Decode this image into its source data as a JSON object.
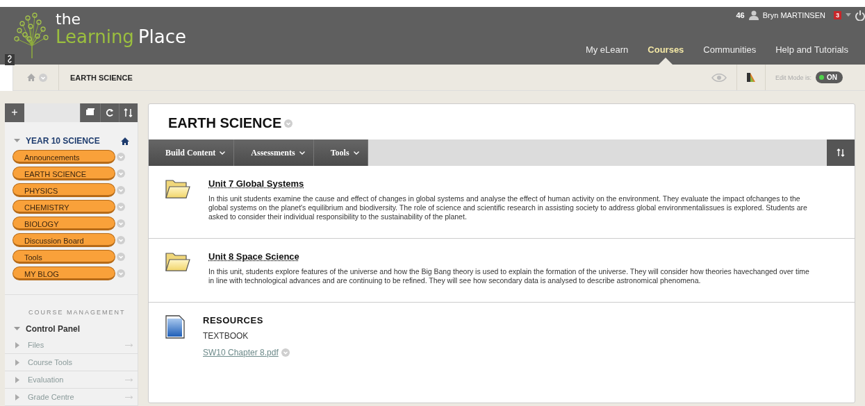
{
  "header": {
    "logo": {
      "small": "the",
      "green": "Learning",
      "white": "Place"
    },
    "user_count": "46",
    "user_name": "Bryn MARTINSEN",
    "notification_count": "3",
    "nav": [
      {
        "label": "My eLearn",
        "selected": false
      },
      {
        "label": "Courses",
        "selected": true
      },
      {
        "label": "Communities",
        "selected": false
      },
      {
        "label": "Help and Tutorials",
        "selected": false
      }
    ]
  },
  "breadcrumb": {
    "current": "EARTH SCIENCE",
    "edit_mode_label": "Edit Mode is:",
    "edit_mode": {
      "label": "ON",
      "on": true
    }
  },
  "sidebar": {
    "add_label": "+",
    "course_title": "YEAR 10 SCIENCE",
    "course_expanded": true,
    "menu_items": [
      {
        "label": "Announcements"
      },
      {
        "label": "EARTH SCIENCE"
      },
      {
        "label": "PHYSICS"
      },
      {
        "label": "CHEMISTRY"
      },
      {
        "label": "BIOLOGY"
      },
      {
        "label": "Discussion Board"
      },
      {
        "label": "Tools"
      },
      {
        "label": "MY BLOG"
      }
    ],
    "management_heading": "COURSE MANAGEMENT",
    "control_panel": {
      "label": "Control Panel",
      "expanded": true,
      "items": [
        {
          "label": "Files",
          "expanded": false,
          "link_arrow": true
        },
        {
          "label": "Course Tools",
          "expanded": false,
          "link_arrow": false
        },
        {
          "label": "Evaluation",
          "expanded": false,
          "link_arrow": true
        },
        {
          "label": "Grade Centre",
          "expanded": false,
          "link_arrow": true
        }
      ]
    }
  },
  "content": {
    "title": "EARTH SCIENCE",
    "action_menus": [
      {
        "label": "Build Content"
      },
      {
        "label": "Assessments"
      },
      {
        "label": "Tools"
      }
    ],
    "items": [
      {
        "kind": "folder",
        "title": "Unit 7 Global Systems",
        "description": "In this unit students examine the cause and effect of changes in global systems and analyse the effect of human activity on the environment. They evaluate the impact ofchanges to the global systems on the planet's equilibrium and biodiversity. The role of science and scientific research in assisting society to address global environmentalissues is explored. Students are asked to consider their individual responsibility to the sustainability of the planet."
      },
      {
        "kind": "folder",
        "title": "Unit 8 Space Science",
        "description": "In this unit, students explore features of the universe and how the Big Bang theory is used to explain the formation of the universe. They will consider how theories havechanged over time in line with technological advances and are continuing to be refined. They will see how secondary data is analysed to describe astronomical phenomena."
      },
      {
        "kind": "file",
        "title": "RESOURCES",
        "subtitle": "TEXTBOOK",
        "attachment": "SW10 Chapter 8.pdf"
      }
    ]
  }
}
